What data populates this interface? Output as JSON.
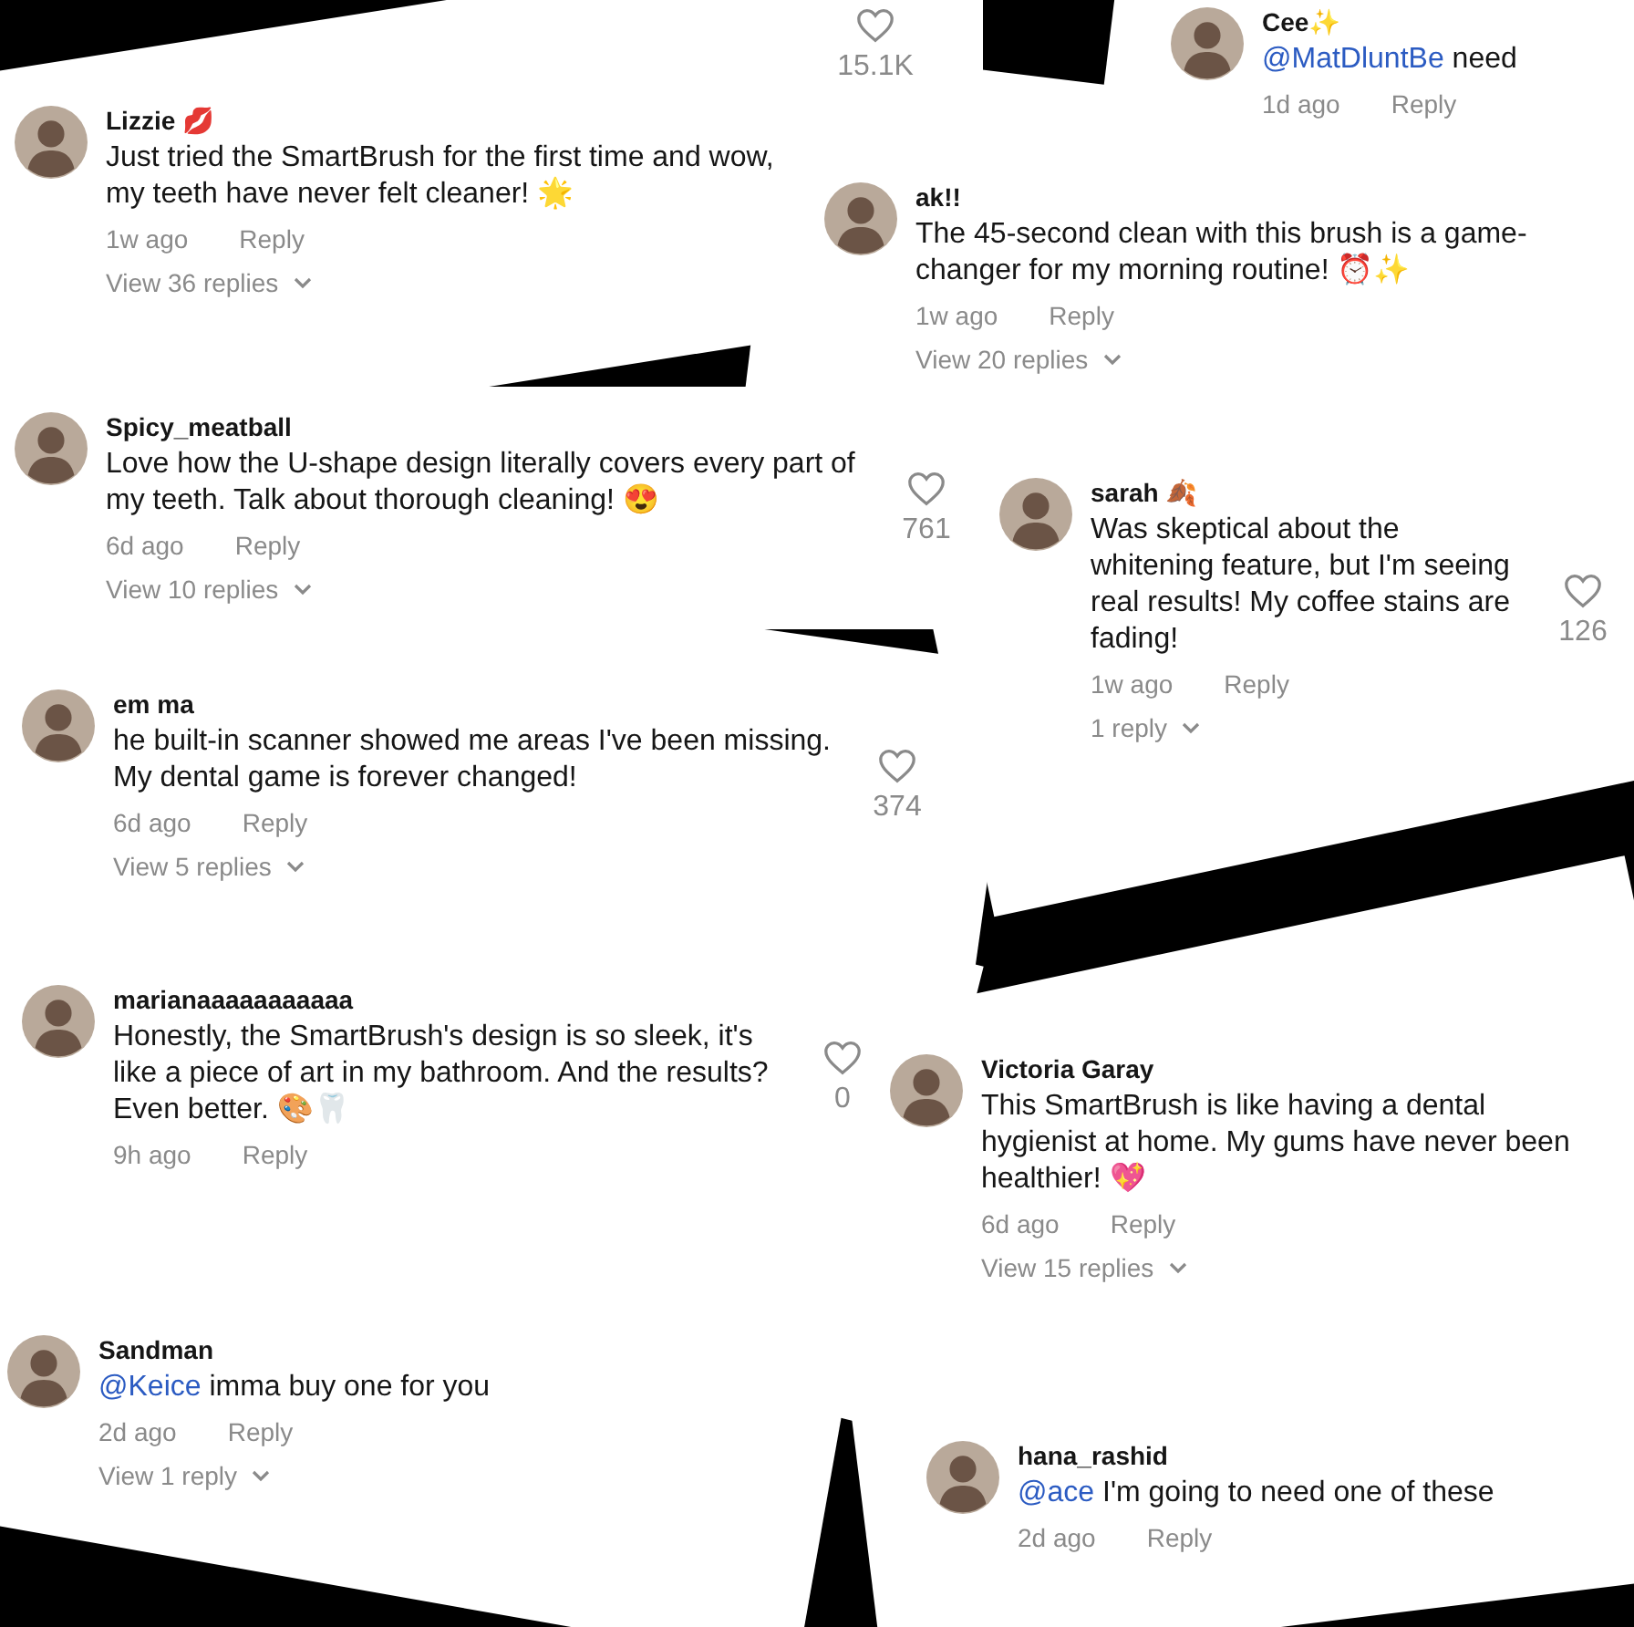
{
  "comments": [
    {
      "kind": "fragment",
      "likes": "15.1K"
    },
    {
      "kind": "comment",
      "author": "Lizzie 💋",
      "text": "Just tried the SmartBrush for the first time and wow, my teeth have never felt cleaner! 🌟",
      "time": "1w ago",
      "reply": "Reply",
      "replies": "View 36 replies"
    },
    {
      "kind": "comment",
      "author": "Cee✨",
      "mention": "@MatDluntBe",
      "text": "need",
      "time": "1d ago",
      "reply": "Reply"
    },
    {
      "kind": "comment",
      "author": "ak!!",
      "text": "The 45-second clean with this brush is a game-changer for my morning routine! ⏰✨",
      "time": "1w ago",
      "reply": "Reply",
      "replies": "View 20 replies"
    },
    {
      "kind": "comment",
      "author": "Spicy_meatball",
      "text": "Love how the U-shape design literally covers every part of my teeth. Talk about thorough cleaning! 😍",
      "time": "6d ago",
      "reply": "Reply",
      "replies": "View 10 replies",
      "likes": "761"
    },
    {
      "kind": "comment",
      "author": "sarah 🍂",
      "text": "Was skeptical about the whitening feature, but I'm seeing real results! My coffee stains are fading!",
      "time": "1w ago",
      "reply": "Reply",
      "replies": "1 reply",
      "likes": "126"
    },
    {
      "kind": "comment",
      "author": "em ma",
      "text": "he built-in scanner showed me areas I've been missing. My dental game is forever changed!",
      "time": "6d ago",
      "reply": "Reply",
      "replies": "View 5 replies",
      "likes": "374"
    },
    {
      "kind": "comment",
      "author": "marianaaaaaaaaaaa",
      "text": "Honestly, the SmartBrush's design is so sleek, it's like a piece of art in my bathroom. And the results? Even better. 🎨🦷",
      "time": "9h ago",
      "reply": "Reply",
      "likes": "0"
    },
    {
      "kind": "comment",
      "author": "Victoria Garay",
      "text": "This SmartBrush is like having a dental hygienist at home. My gums have never been healthier! 💖",
      "time": "6d ago",
      "reply": "Reply",
      "replies": "View 15 replies"
    },
    {
      "kind": "comment",
      "author": "Sandman",
      "mention": "@Keice",
      "text": "imma buy one for you",
      "time": "2d ago",
      "reply": "Reply",
      "replies": "View 1 reply"
    },
    {
      "kind": "comment",
      "author": "hana_rashid",
      "mention": "@ace",
      "text": "I'm going to need one of these",
      "time": "2d ago",
      "reply": "Reply"
    }
  ]
}
